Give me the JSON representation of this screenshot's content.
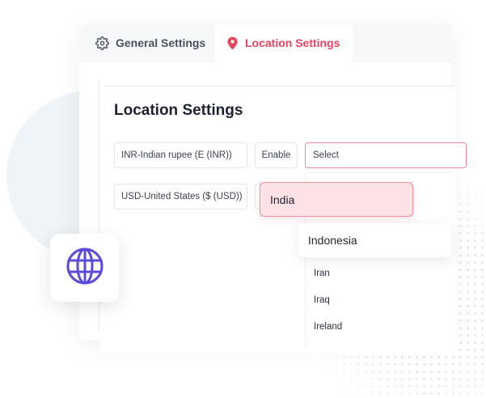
{
  "tabs": {
    "general": {
      "label": "General Settings",
      "icon": "gear-icon"
    },
    "location": {
      "label": "Location Settings",
      "icon": "location-pin-icon",
      "active": true
    }
  },
  "panel": {
    "title": "Location Settings"
  },
  "rows": [
    {
      "currency": "INR-Indian rupee (E (INR))",
      "action": "Enable"
    },
    {
      "currency": "USD-United States ($ (USD))",
      "action": ""
    }
  ],
  "country_select": {
    "value": "Select"
  },
  "country_options": {
    "highlighted": "India",
    "hovered": "Indonesia",
    "list": [
      "Iran",
      "Iraq",
      "Ireland"
    ]
  },
  "badge": {
    "icon": "globe-icon"
  },
  "colors": {
    "accent": "#e64560",
    "highlight_bg": "#fde2e6",
    "globe": "#5b4bdb"
  }
}
